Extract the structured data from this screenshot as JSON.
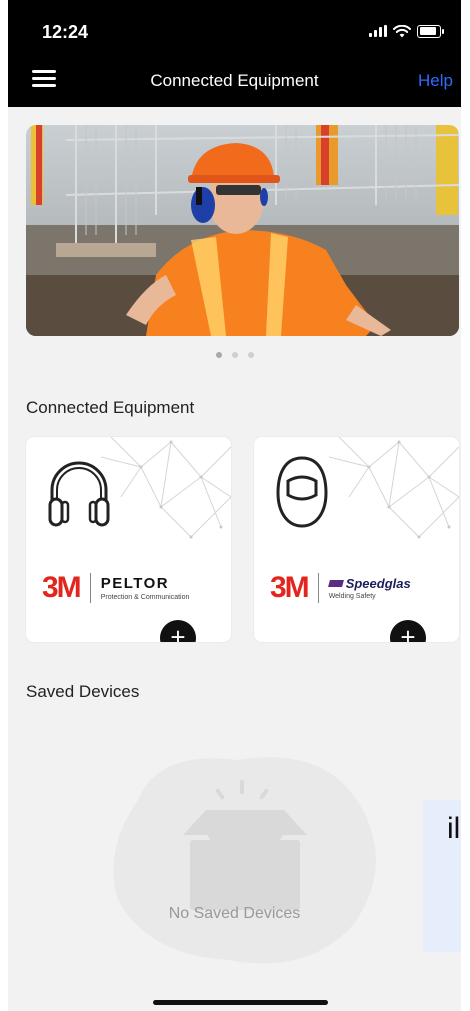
{
  "status": {
    "time": "12:24"
  },
  "header": {
    "title": "Connected Equipment",
    "help": "Help"
  },
  "carousel": {
    "pages": 3,
    "active_index": 0
  },
  "connected": {
    "title": "Connected Equipment",
    "cards": [
      {
        "brand_logo": "3M",
        "brand_name": "PELTOR",
        "brand_sub": "Protection & Communication",
        "icon": "headphones-icon"
      },
      {
        "brand_logo": "3M",
        "brand_name": "Speedglas",
        "brand_sub": "Welding Safety",
        "icon": "welding-helmet-icon"
      }
    ]
  },
  "saved": {
    "title": "Saved Devices",
    "empty_text": "No Saved Devices"
  },
  "overlay": {
    "text": "il"
  },
  "colors": {
    "header_bg": "#000000",
    "help_link": "#2f6bff",
    "brand_red": "#e2261d",
    "page_bg": "#f2f2f2"
  }
}
